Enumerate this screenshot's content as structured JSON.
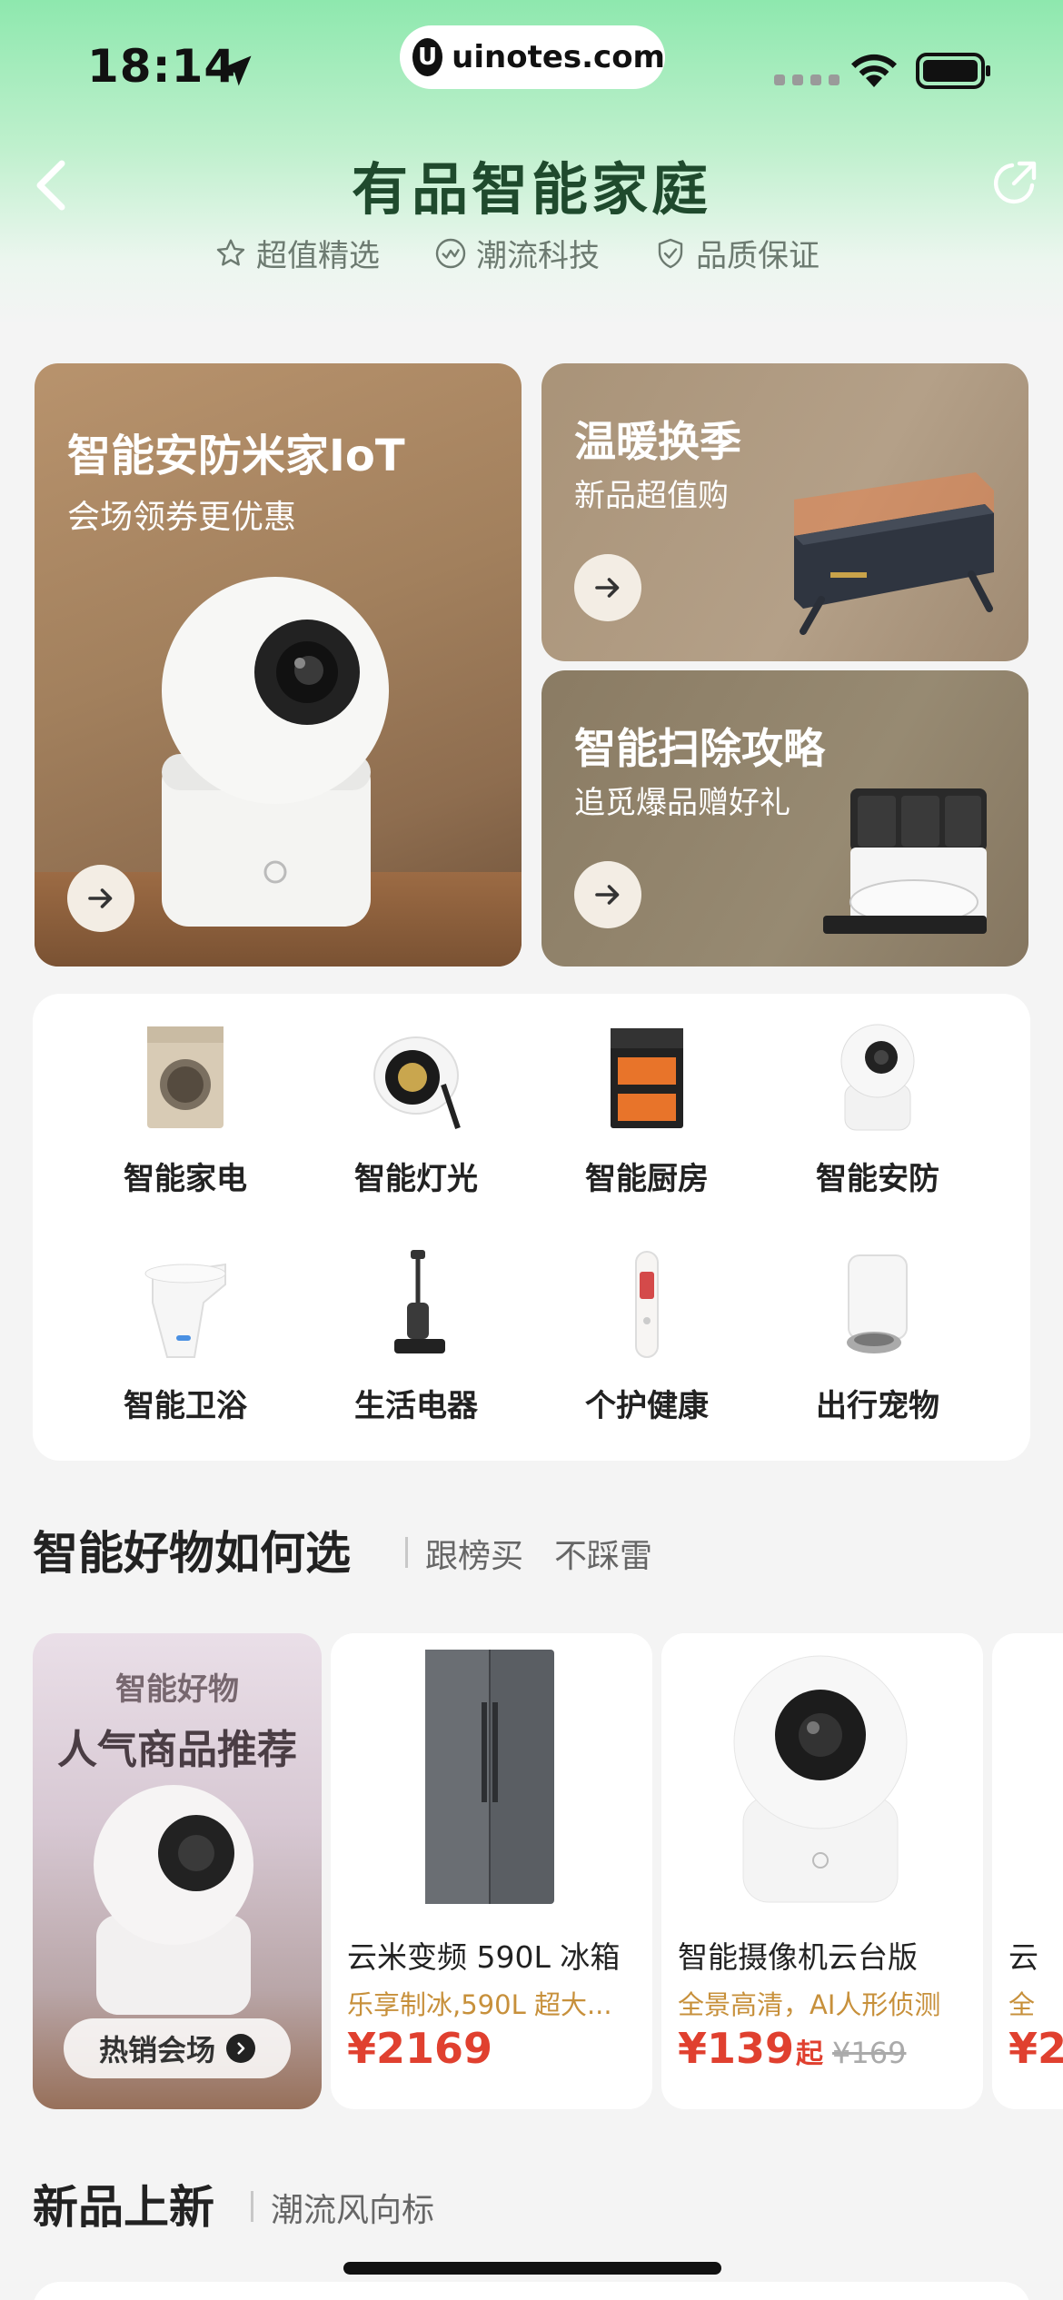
{
  "status_bar": {
    "time": "18:14",
    "url_logo": "U",
    "url": "uinotes.com"
  },
  "header": {
    "title": "有品智能家庭",
    "features": [
      "超值精选",
      "潮流科技",
      "品质保证"
    ]
  },
  "banners": {
    "big": {
      "title": "智能安防米家IoT",
      "subtitle": "会场领券更优惠"
    },
    "small1": {
      "title": "温暖换季",
      "subtitle": "新品超值购"
    },
    "small2": {
      "title": "智能扫除攻略",
      "subtitle": "追觅爆品赠好礼"
    }
  },
  "categories": [
    {
      "label": "智能家电",
      "icon": "washing-machine-icon"
    },
    {
      "label": "智能灯光",
      "icon": "spotlight-icon"
    },
    {
      "label": "智能厨房",
      "icon": "kitchen-stove-icon"
    },
    {
      "label": "智能安防",
      "icon": "security-camera-icon"
    },
    {
      "label": "智能卫浴",
      "icon": "smart-toilet-icon"
    },
    {
      "label": "生活电器",
      "icon": "floor-washer-icon"
    },
    {
      "label": "个护健康",
      "icon": "thermometer-icon"
    },
    {
      "label": "出行宠物",
      "icon": "pet-feeder-icon"
    }
  ],
  "section1": {
    "title": "智能好物如何选",
    "sub1": "跟榜买",
    "sub2": "不踩雷"
  },
  "promo": {
    "kicker": "智能好物",
    "title": "人气商品推荐",
    "button": "热销会场"
  },
  "products": [
    {
      "name": "云米变频 590L 冰箱",
      "desc": "乐享制冰,590L 超大...",
      "price": "¥2169",
      "suffix": "",
      "orig": ""
    },
    {
      "name": "智能摄像机云台版",
      "desc": "全景高清，AI人形侦测",
      "price": "¥139",
      "suffix": "起",
      "orig": "¥169"
    },
    {
      "name": "云",
      "desc": "全",
      "price": "¥2",
      "suffix": "",
      "orig": ""
    }
  ],
  "section2": {
    "title": "新品上新",
    "sub": "潮流风向标"
  },
  "colors": {
    "title_green": "#1f4a2d",
    "price_red": "#e0402f",
    "desc_gold": "#c7903b"
  }
}
